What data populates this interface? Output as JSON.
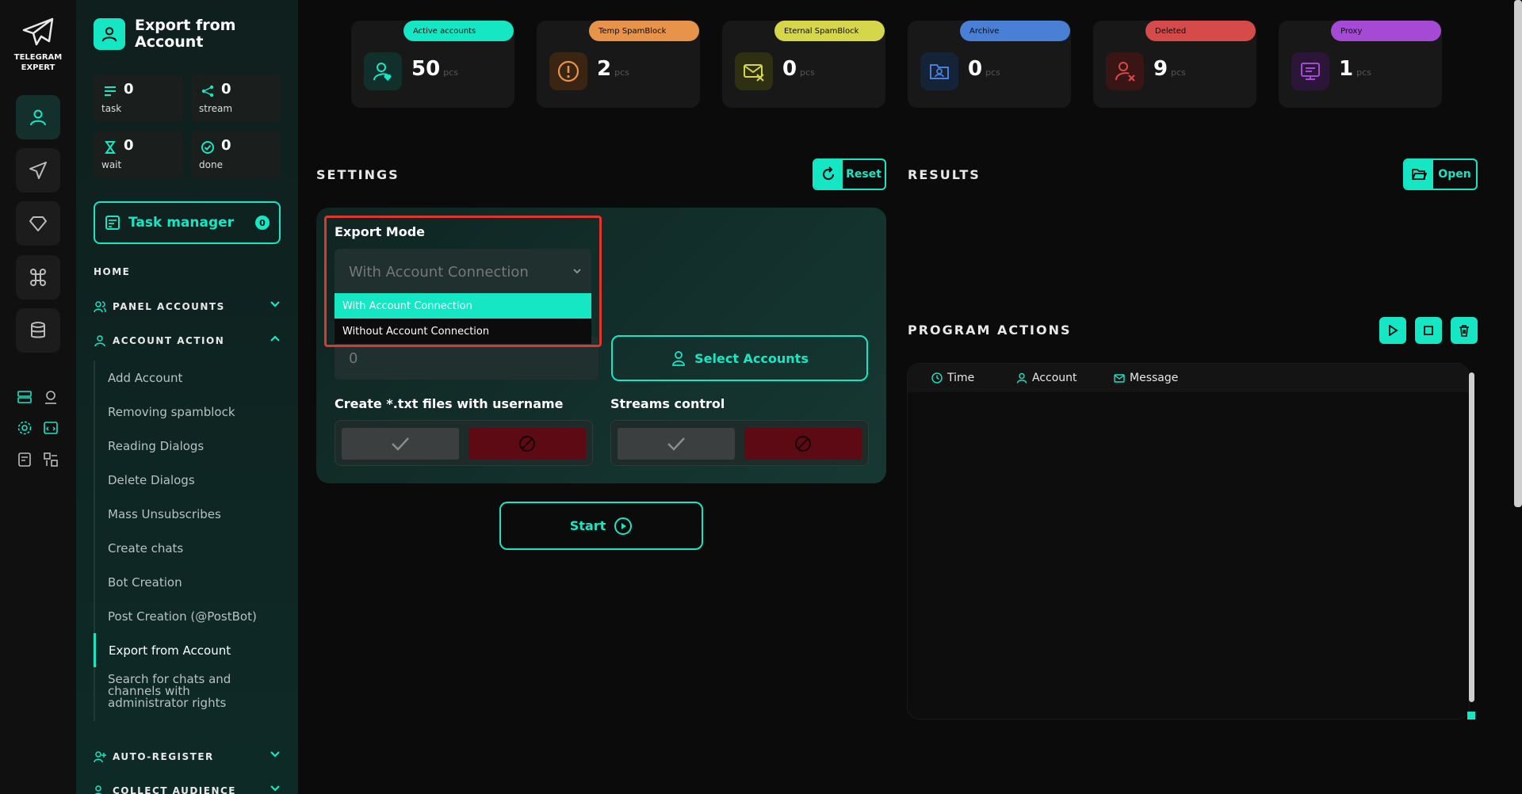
{
  "brand": {
    "line1": "TELEGRAM",
    "line2": "EXPERT"
  },
  "sidebar": {
    "title": "Export from Account",
    "stats": [
      {
        "value": "0",
        "label": "task"
      },
      {
        "value": "0",
        "label": "stream"
      },
      {
        "value": "0",
        "label": "wait"
      },
      {
        "value": "0",
        "label": "done"
      }
    ],
    "task_manager": {
      "label": "Task manager",
      "count": "0"
    },
    "home": "HOME",
    "panel_accounts": "PANEL ACCOUNTS",
    "account_action": "ACCOUNT ACTION",
    "items": [
      "Add Account",
      "Removing spamblock",
      "Reading Dialogs",
      "Delete Dialogs",
      "Mass Unsubscribes",
      "Create chats",
      "Bot Creation",
      "Post Creation (@PostBot)",
      "Export from Account",
      "Search for chats and channels with administrator rights"
    ],
    "auto_register": "AUTO-REGISTER",
    "collect_audience": "COLLECT AUDIENCE"
  },
  "cards": [
    {
      "label": "Active accounts",
      "value": "50",
      "unit": "pcs",
      "color": "#15e6c4"
    },
    {
      "label": "Temp SpamBlock",
      "value": "2",
      "unit": "pcs",
      "color": "#e8934a"
    },
    {
      "label": "Eternal SpamBlock",
      "value": "0",
      "unit": "pcs",
      "color": "#d6d64a"
    },
    {
      "label": "Archive",
      "value": "0",
      "unit": "pcs",
      "color": "#4a7fd6"
    },
    {
      "label": "Deleted",
      "value": "9",
      "unit": "pcs",
      "color": "#d64a4a"
    },
    {
      "label": "Proxy",
      "value": "1",
      "unit": "pcs",
      "color": "#a64ad6"
    }
  ],
  "settings": {
    "title": "SETTINGS",
    "reset": "Reset",
    "export_mode_label": "Export Mode",
    "export_mode_value": "With Account Connection",
    "options": [
      "With Account Connection",
      "Without Account Connection"
    ],
    "number_value": "0",
    "select_accounts": "Select Accounts",
    "create_txt_label": "Create *.txt files with username",
    "streams_label": "Streams control",
    "start": "Start"
  },
  "results": {
    "title": "RESULTS",
    "open": "Open"
  },
  "program_actions": {
    "title": "PROGRAM ACTIONS",
    "columns": [
      "Time",
      "Account",
      "Message"
    ]
  },
  "colors": {
    "accent": "#15e6c4",
    "danger": "#5e0a14",
    "highlight": "#e0342c"
  }
}
